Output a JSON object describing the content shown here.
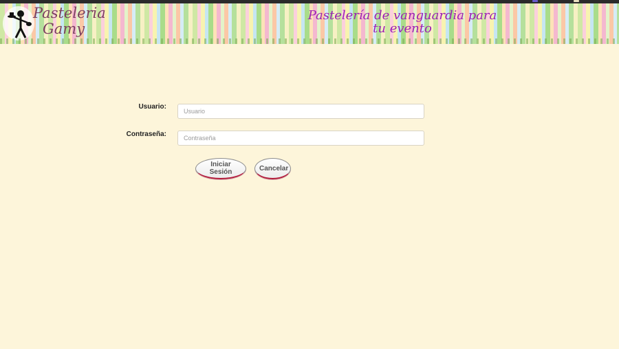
{
  "header": {
    "logo_line1": "Pasteleria",
    "logo_line2": "Gamy",
    "tagline": "Pastelería de vanguardia para tu evento",
    "colors": {
      "tagline": "#9b1fb3",
      "logo_text": "#7a3f5f"
    }
  },
  "login_form": {
    "username_label": "Usuario:",
    "username_placeholder": "Usuario",
    "username_value": "",
    "password_label": "Contraseña:",
    "password_placeholder": "Contraseña",
    "password_value": "",
    "login_button": "Iniciar Sesión",
    "cancel_button": "Cancelar"
  },
  "icons": {
    "logo": "chef-figure-icon"
  },
  "colors": {
    "page_background": "#fdf5da",
    "button_accent": "#b31d3c"
  }
}
